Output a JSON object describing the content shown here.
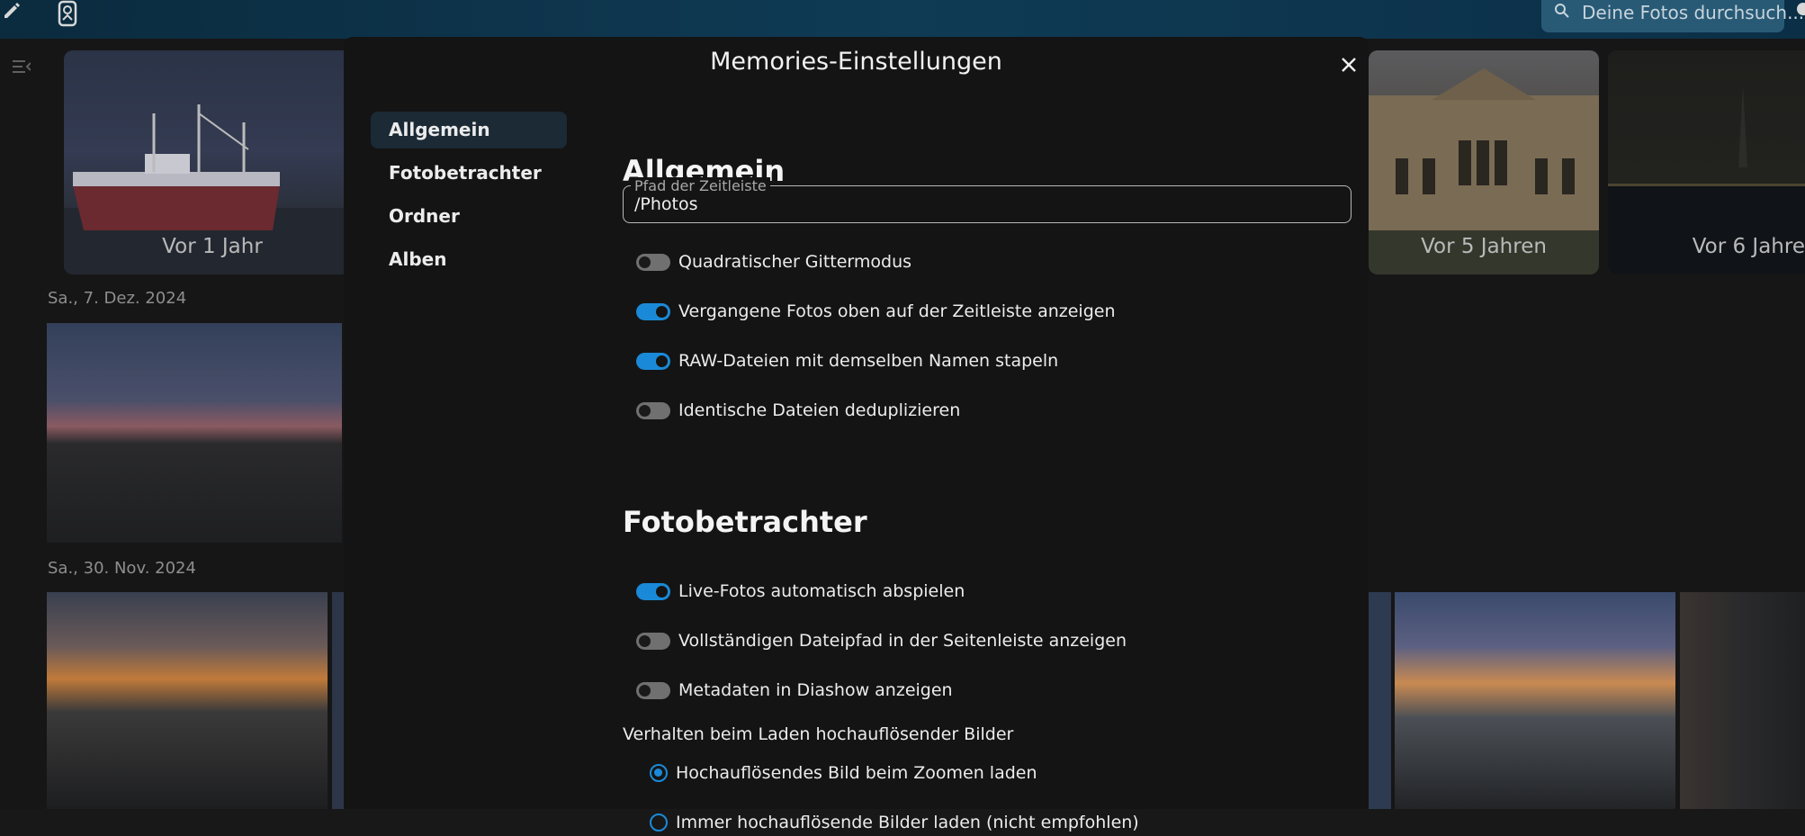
{
  "header": {
    "search_placeholder": "Deine Fotos durchsuch..."
  },
  "background": {
    "memories": [
      {
        "label": "Vor 1 Jahr"
      },
      {
        "label": "Vor 5 Jahren"
      },
      {
        "label": "Vor 6 Jahre"
      }
    ],
    "date_labels": [
      "Sa., 7. Dez. 2024",
      "Sa., 30. Nov. 2024"
    ]
  },
  "modal": {
    "title": "Memories-Einstellungen",
    "nav": [
      {
        "label": "Allgemein",
        "active": true
      },
      {
        "label": "Fotobetrachter",
        "active": false
      },
      {
        "label": "Ordner",
        "active": false
      },
      {
        "label": "Alben",
        "active": false
      }
    ],
    "general": {
      "heading": "Allgemein",
      "timeline_path": {
        "label": "Pfad der Zeitleiste",
        "value": "/Photos"
      },
      "toggles": [
        {
          "label": "Quadratischer Gittermodus",
          "on": false
        },
        {
          "label": "Vergangene Fotos oben auf der Zeitleiste anzeigen",
          "on": true
        },
        {
          "label": "RAW-Dateien mit demselben Namen stapeln",
          "on": true
        },
        {
          "label": "Identische Dateien deduplizieren",
          "on": false
        }
      ]
    },
    "viewer": {
      "heading": "Fotobetrachter",
      "toggles": [
        {
          "label": "Live-Fotos automatisch abspielen",
          "on": true
        },
        {
          "label": "Vollständigen Dateipfad in der Seitenleiste anzeigen",
          "on": false
        },
        {
          "label": "Metadaten in Diashow anzeigen",
          "on": false
        }
      ],
      "hires_group_label": "Verhalten beim Laden hochauflösender Bilder",
      "hires_options": [
        {
          "label": "Hochauflösendes Bild beim Zoomen laden",
          "checked": true
        },
        {
          "label": "Immer hochauflösende Bilder laden (nicht empfohlen)",
          "checked": false
        }
      ]
    }
  },
  "colors": {
    "accent": "#1a8ad8",
    "modal_bg": "#141414",
    "topbar": "#0f3b55"
  }
}
